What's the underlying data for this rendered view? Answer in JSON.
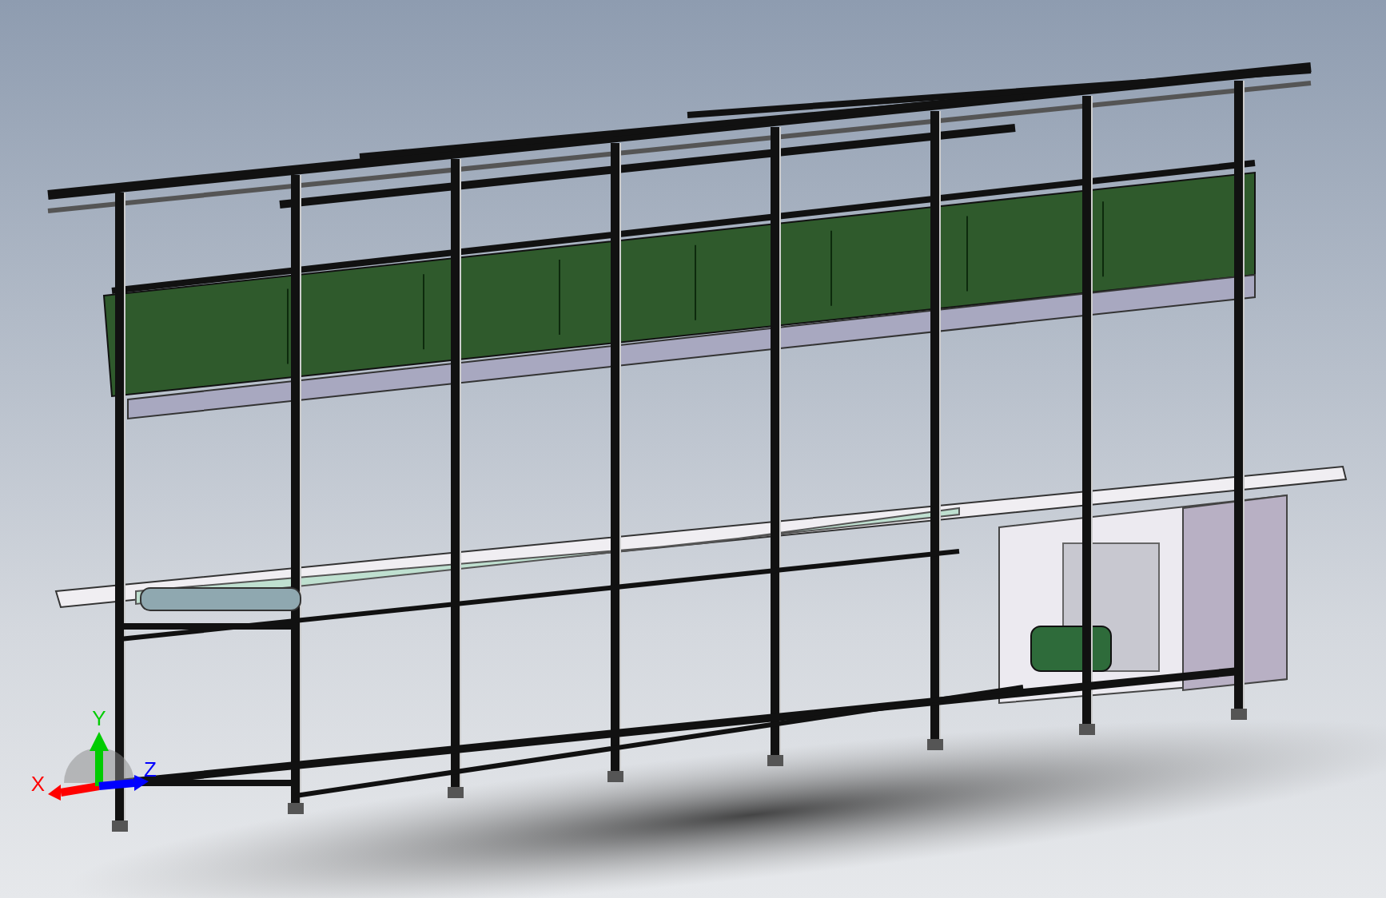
{
  "view_triad": {
    "axes": [
      {
        "label": "X",
        "color": "#ff0000"
      },
      {
        "label": "Y",
        "color": "#00cc00"
      },
      {
        "label": "Z",
        "color": "#0000ff"
      }
    ]
  }
}
